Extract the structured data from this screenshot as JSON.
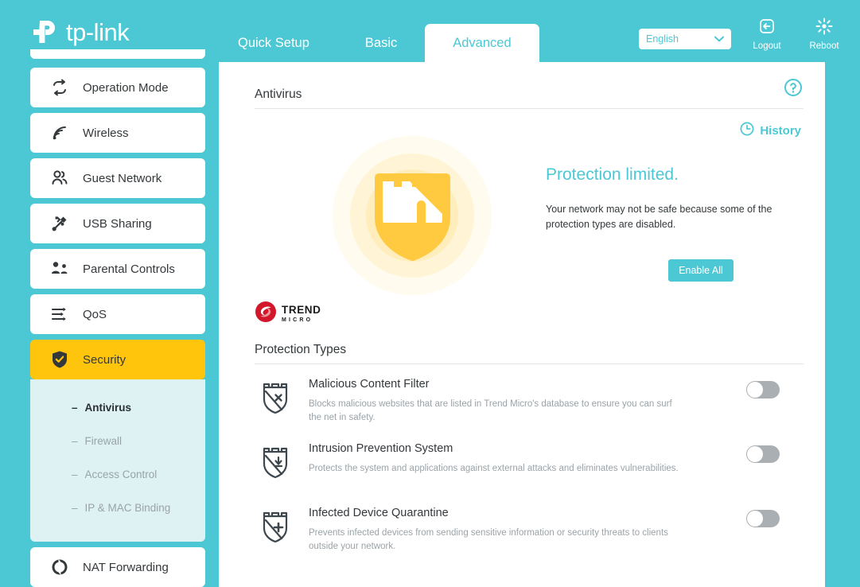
{
  "header": {
    "brand": "tp-link",
    "brand_icon": "tp-link-logo",
    "tabs": [
      {
        "label": "Quick Setup",
        "active": false
      },
      {
        "label": "Basic",
        "active": false
      },
      {
        "label": "Advanced",
        "active": true
      }
    ],
    "language": {
      "value": "English",
      "icon": "chevron-down-icon"
    },
    "logout": {
      "label": "Logout",
      "icon": "logout-icon"
    },
    "reboot": {
      "label": "Reboot",
      "icon": "reboot-icon"
    }
  },
  "sidebar": {
    "items": [
      {
        "label": "Operation Mode",
        "icon": "operation-mode-icon",
        "active": false
      },
      {
        "label": "Wireless",
        "icon": "wireless-icon",
        "active": false
      },
      {
        "label": "Guest Network",
        "icon": "guest-network-icon",
        "active": false
      },
      {
        "label": "USB Sharing",
        "icon": "usb-sharing-icon",
        "active": false
      },
      {
        "label": "Parental Controls",
        "icon": "parental-controls-icon",
        "active": false
      },
      {
        "label": "QoS",
        "icon": "qos-icon",
        "active": false
      },
      {
        "label": "Security",
        "icon": "security-shield-icon",
        "active": true
      },
      {
        "label": "NAT Forwarding",
        "icon": "nat-forwarding-icon",
        "active": false
      }
    ],
    "subitems": [
      {
        "label": "Antivirus",
        "active": true
      },
      {
        "label": "Firewall",
        "active": false
      },
      {
        "label": "Access Control",
        "active": false
      },
      {
        "label": "IP & MAC Binding",
        "active": false
      }
    ],
    "dash": "–"
  },
  "main": {
    "page_title": "Antivirus",
    "help_icon": "help-question-icon",
    "history": {
      "label": "History",
      "icon": "clock-icon"
    },
    "status": {
      "icon": "warning-shield-icon",
      "headline": "Protection limited.",
      "description": "Your network may not be safe because some of the protection types are disabled.",
      "action_label": "Enable All"
    },
    "vendor": {
      "icon": "trend-micro-icon",
      "line1": "TREND",
      "line2": "MICRO"
    },
    "protection_types": {
      "section_title": "Protection Types",
      "rows": [
        {
          "icon": "shield-x-icon",
          "name": "Malicious Content Filter",
          "description": "Blocks malicious websites that are listed in Trend Micro's database to ensure you can surf the net in safety.",
          "toggle_state": "off"
        },
        {
          "icon": "shield-download-icon",
          "name": "Intrusion Prevention System",
          "description": "Protects the system and applications against external attacks and eliminates vulnerabilities.",
          "toggle_state": "off"
        },
        {
          "icon": "shield-plus-icon",
          "name": "Infected Device Quarantine",
          "description": "Prevents infected devices from sending sensitive information or security threats to clients outside your network.",
          "toggle_state": "off"
        }
      ]
    }
  },
  "colors": {
    "brand_teal": "#4CC8D4",
    "accent_yellow": "#FFC40C",
    "text_dark": "#33383B",
    "text_muted": "#9AA3A8",
    "toggle_off": "#AAAFB3",
    "subnav_bg": "#DEF2F4"
  }
}
